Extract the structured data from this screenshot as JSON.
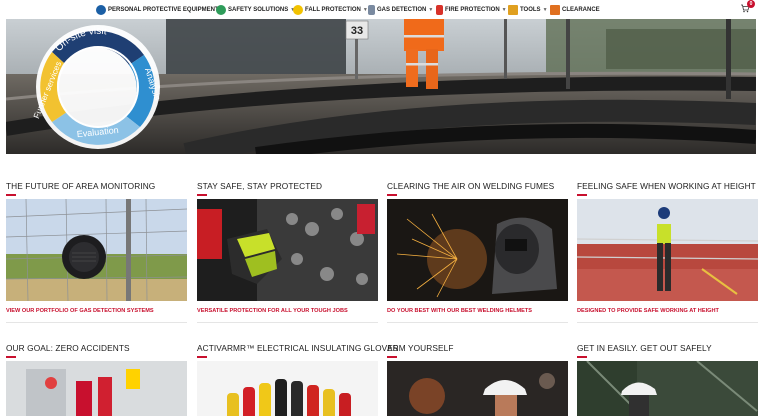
{
  "nav": {
    "items": [
      {
        "label": "PERSONAL PROTECTIVE EQUIPMENT",
        "icon": "ppe-icon",
        "color": "#1b5fa5"
      },
      {
        "label": "SAFETY SOLUTIONS",
        "icon": "solutions-icon",
        "color": "#2e9c5a"
      },
      {
        "label": "FALL PROTECTION",
        "icon": "fall-protection-icon",
        "color": "#f2c200"
      },
      {
        "label": "GAS DETECTION",
        "icon": "gas-detection-icon",
        "color": "#7a8aa0"
      },
      {
        "label": "FIRE PROTECTION",
        "icon": "fire-protection-icon",
        "color": "#d8322a"
      },
      {
        "label": "TOOLS",
        "icon": "tools-icon",
        "color": "#e0a020"
      },
      {
        "label": "CLEARANCE",
        "icon": "clearance-icon",
        "color": "#e07020"
      }
    ],
    "cart_count": "0"
  },
  "hero": {
    "cycle": [
      "On-site visit",
      "Analysis",
      "Evaluation",
      "Further services"
    ],
    "sign_number": "33",
    "colors": {
      "navy": "#1f3f73",
      "blue": "#2f8fd0",
      "light_blue": "#8cc2e6",
      "yellow": "#f2c230"
    }
  },
  "cards": [
    {
      "title": "THE FUTURE OF AREA MONITORING",
      "link": "VIEW OUR PORTFOLIO OF GAS DETECTION SYSTEMS"
    },
    {
      "title": "STAY SAFE, STAY PROTECTED",
      "link": "VERSATILE PROTECTION FOR ALL YOUR TOUGH JOBS"
    },
    {
      "title": "CLEARING THE AIR ON WELDING FUMES",
      "link": "DO YOUR BEST WITH OUR BEST WELDING HELMETS"
    },
    {
      "title": "FEELING SAFE WHEN WORKING AT HEIGHT",
      "link": "DESIGNED TO PROVIDE SAFE WORKING AT HEIGHT"
    },
    {
      "title": "OUR GOAL: ZERO ACCIDENTS"
    },
    {
      "title": "ACTIVARMR™ ELECTRICAL INSULATING GLOVES"
    },
    {
      "title": "ARM YOURSELF"
    },
    {
      "title": "GET IN EASILY. GET OUT SAFELY"
    }
  ],
  "colors": {
    "accent": "#c8102e"
  }
}
